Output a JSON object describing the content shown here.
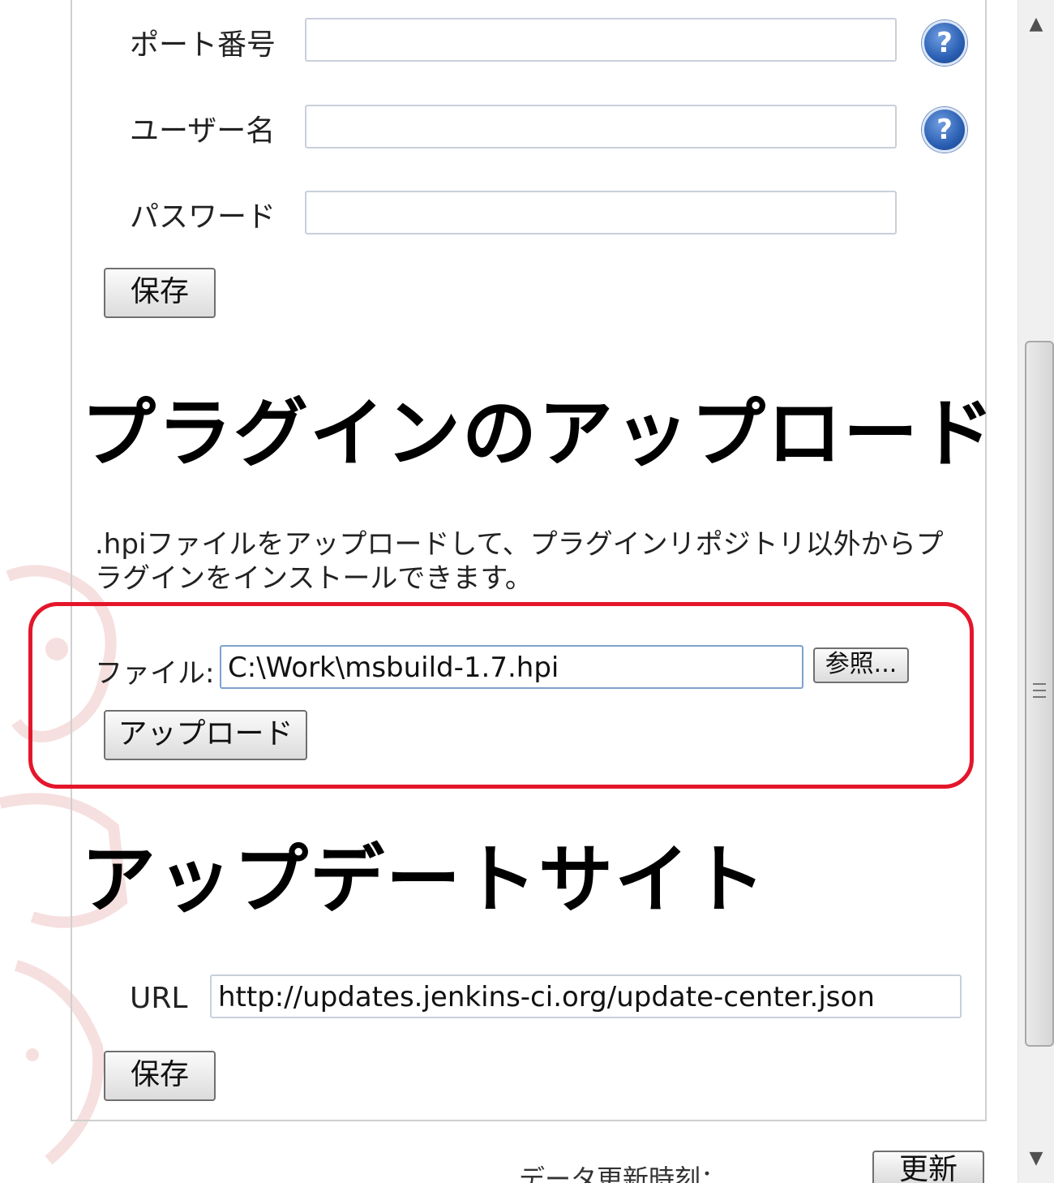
{
  "proxy": {
    "port_label": "ポート番号",
    "port_value": "",
    "username_label": "ユーザー名",
    "username_value": "",
    "password_label": "パスワード",
    "password_value": "",
    "help_symbol": "?",
    "save_label": "保存"
  },
  "upload": {
    "heading": "プラグインのアップロード",
    "description": ".hpiファイルをアップロードして、プラグインリポジトリ以外からプラグインをインストールできます。",
    "file_label": "ファイル:",
    "file_value": "C:\\Work\\msbuild-1.7.hpi",
    "browse_label": "参照...",
    "upload_label": "アップロード",
    "highlight_color": "#e4162a"
  },
  "update_site": {
    "heading": "アップデートサイト",
    "url_label": "URL",
    "url_value": "http://updates.jenkins-ci.org/update-center.json",
    "save_label": "保存"
  },
  "footer": {
    "partial_text": "データ更新時刻：...",
    "refresh_label": "更新"
  },
  "scrollbar": {
    "up_icon": "▲",
    "down_icon": "▼"
  }
}
